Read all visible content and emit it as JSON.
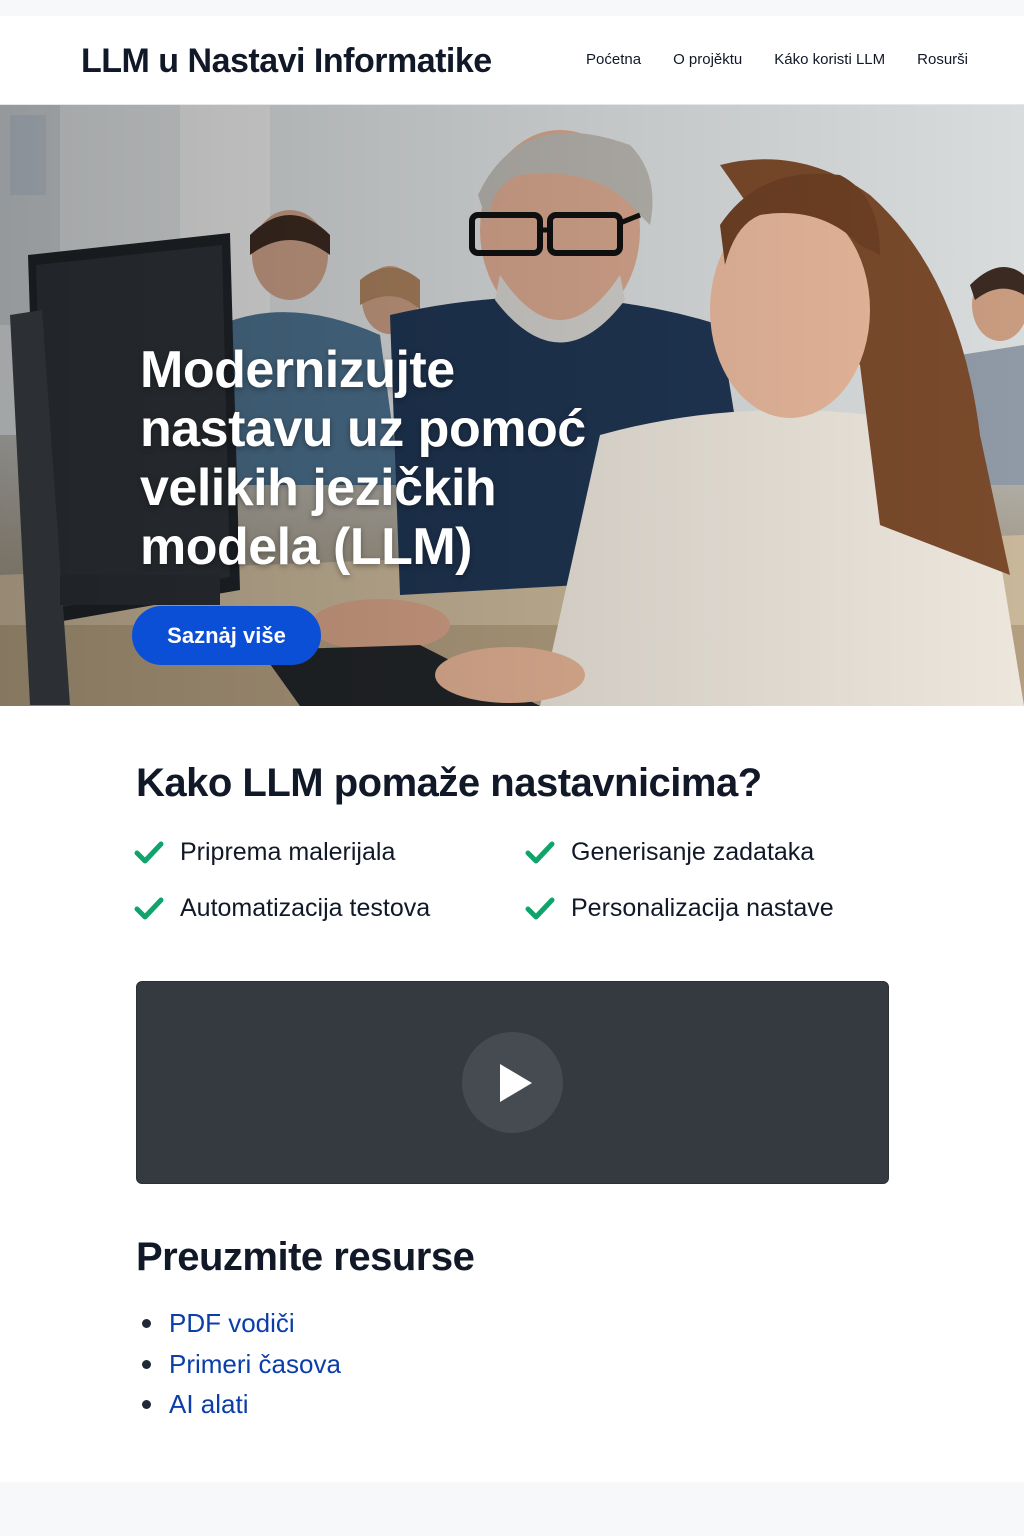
{
  "header": {
    "brand": "LLM u Nastavi Informatike",
    "nav": [
      "Poćetna",
      "O projěktu",
      "Káko koristi LLM",
      "Rosurši"
    ]
  },
  "hero": {
    "title": "Modernizujte nastavu uz pomoć velikih jezičkih modela (LLM)",
    "button_label": "Saznȧj više"
  },
  "features": {
    "title": "Kako LLM pomaže nastavnicima?",
    "items": [
      "Priprema malerijala",
      "Generisanje zadataka",
      "Automatizacija testova",
      "Personalizacija nastave"
    ]
  },
  "video": {
    "icon": "play-icon"
  },
  "resources": {
    "title": "Preuzmite resurse",
    "items": [
      "PDF vodiči",
      "Primeri časova",
      "AI alati"
    ]
  },
  "colors": {
    "accent": "#0b4fd6",
    "check": "#10a36b",
    "link": "#0b3ea8",
    "video_bg": "#343a40"
  }
}
